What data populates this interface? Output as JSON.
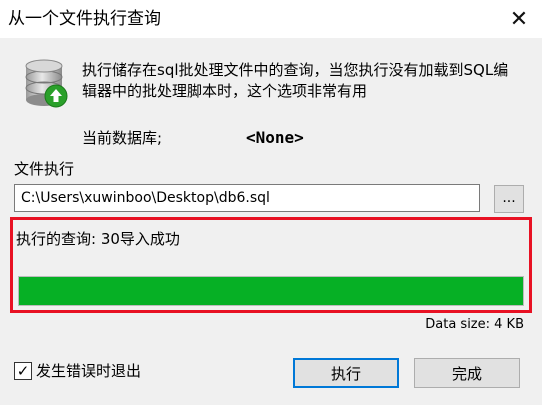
{
  "window": {
    "title": "从一个文件执行查询"
  },
  "description": "执行储存在sql批处理文件中的查询，当您执行没有加载到SQL编辑器中的批处理脚本时，这个选项非常有用",
  "database": {
    "label": "当前数据库;",
    "value": "<None>"
  },
  "file": {
    "label": "文件执行",
    "path": "C:\\Users\\xuwinboo\\Desktop\\db6.sql",
    "browse_label": "..."
  },
  "status": {
    "text": "执行的查询: 30导入成功",
    "progress": 1.0,
    "progress_color": "#06b025",
    "highlight_color": "#e81123"
  },
  "data_size": "Data size: 4 KB",
  "exit_on_error": {
    "label": "发生错误时退出",
    "checked": true
  },
  "buttons": {
    "run": "执行",
    "done": "完成"
  },
  "icons": {
    "close": "close-icon",
    "database": "database-icon"
  }
}
